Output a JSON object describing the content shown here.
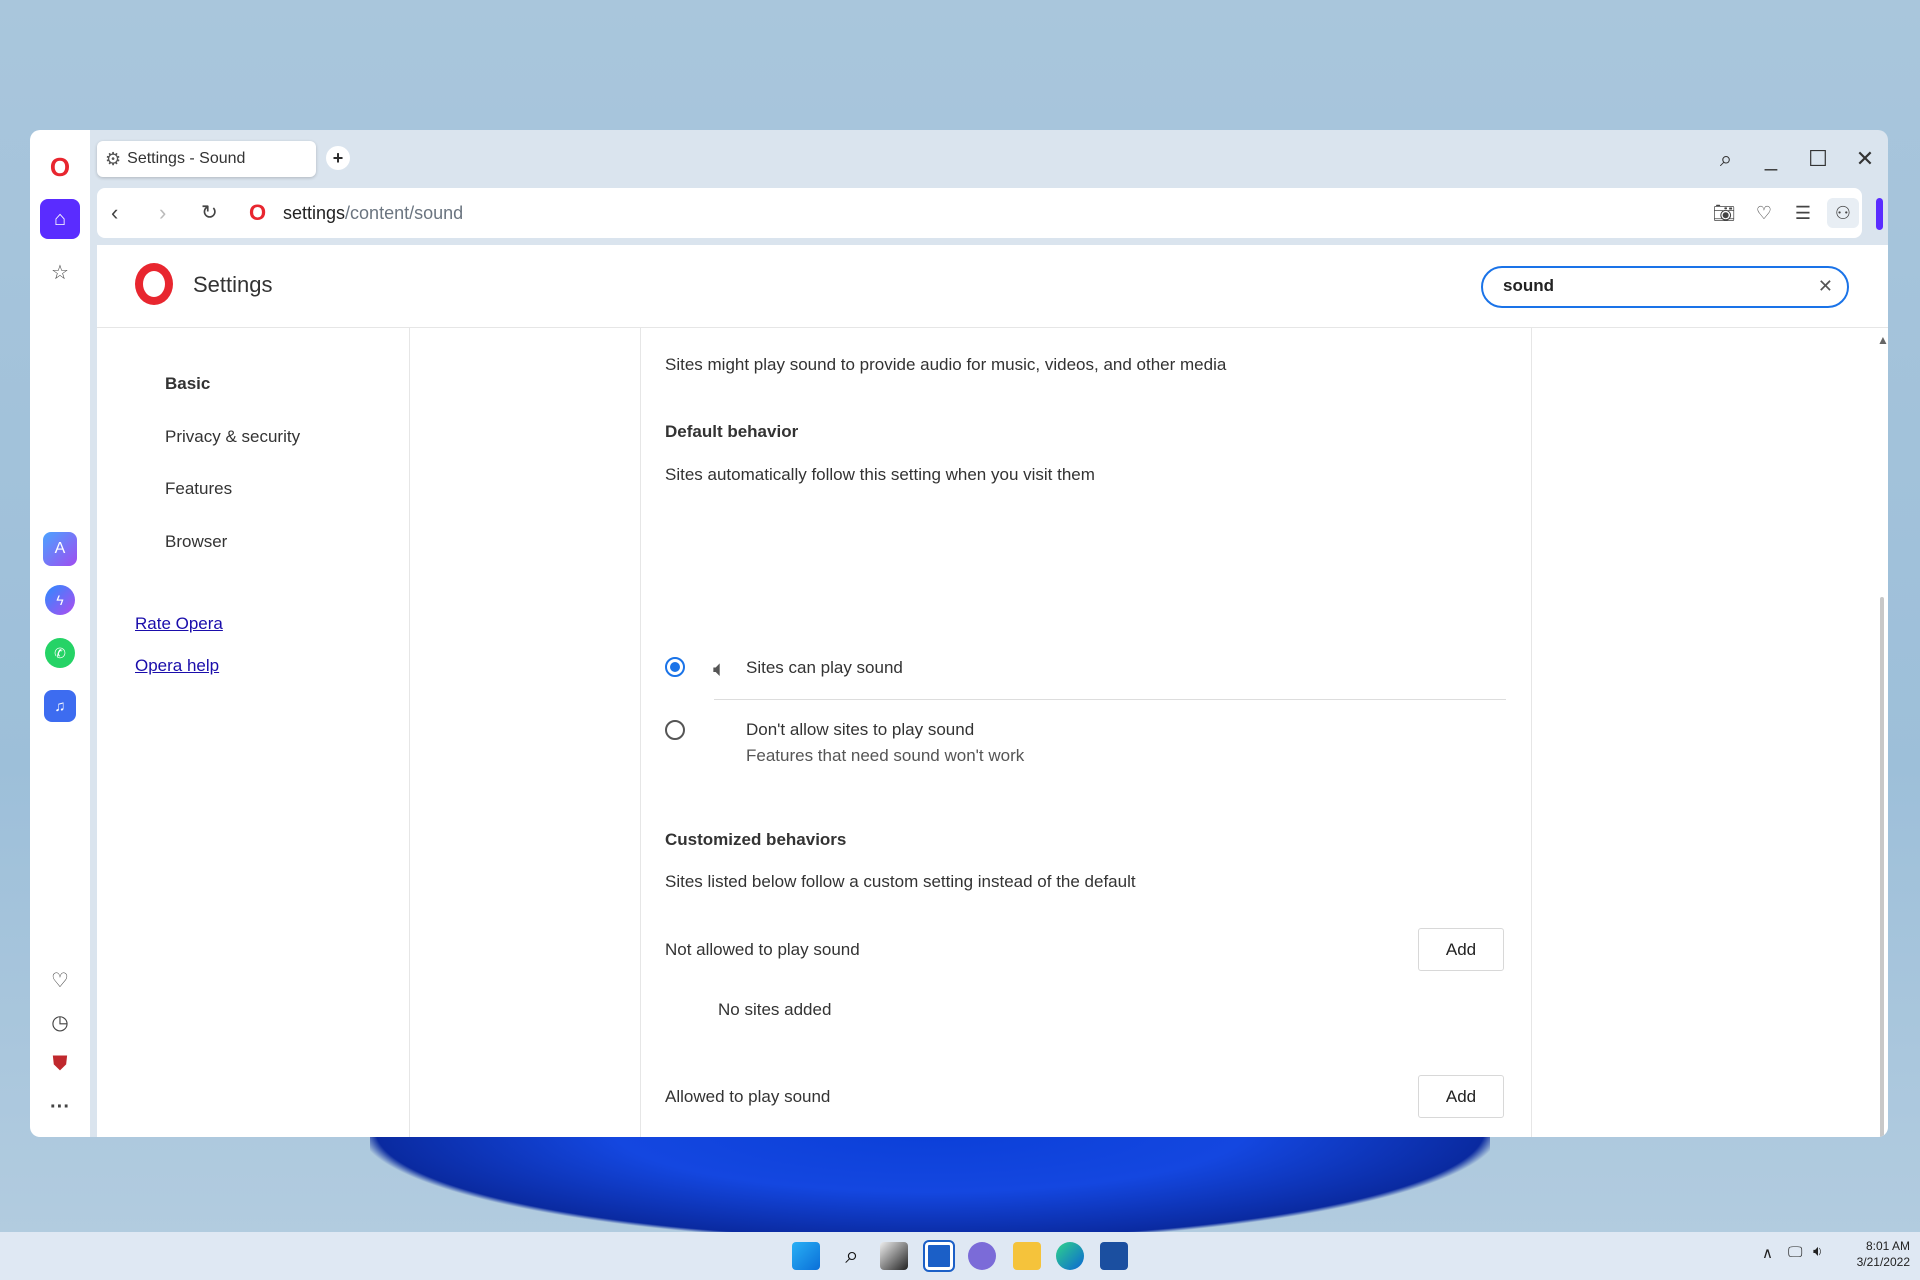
{
  "browser": {
    "tab_title": "Settings - Sound",
    "url_host": "settings",
    "url_path": "/content/sound",
    "accent": "#5a2cff"
  },
  "settings": {
    "title": "Settings",
    "search_value": "sound",
    "nav": [
      "Basic",
      "Privacy & security",
      "Features",
      "Browser"
    ],
    "links": [
      "Rate Opera",
      "Opera help"
    ]
  },
  "sound": {
    "intro": "Sites might play sound to provide audio for music, videos, and other media",
    "default_heading": "Default behavior",
    "default_desc": "Sites automatically follow this setting when you visit them",
    "option_allow": "Sites can play sound",
    "option_block": "Don't allow sites to play sound",
    "option_block_sub": "Features that need sound won't work",
    "selected": "allow",
    "custom_heading": "Customized behaviors",
    "custom_desc": "Sites listed below follow a custom setting instead of the default",
    "not_allowed_label": "Not allowed to play sound",
    "allowed_label": "Allowed to play sound",
    "add_label": "Add",
    "empty_label": "No sites added"
  },
  "taskbar": {
    "time": "8:01 AM",
    "date": "3/21/2022"
  }
}
